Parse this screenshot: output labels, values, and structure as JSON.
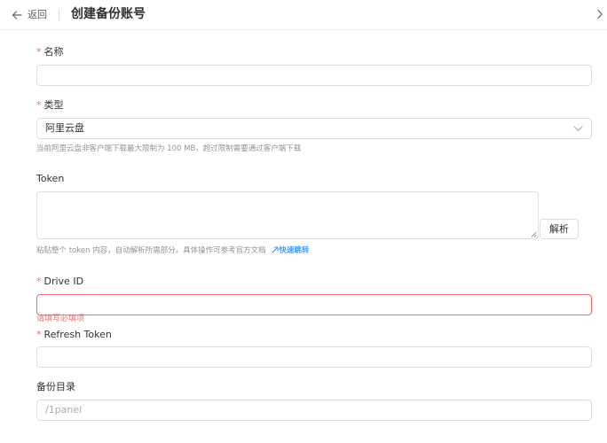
{
  "header": {
    "back_label": "返回",
    "title": "创建备份账号"
  },
  "form": {
    "required_mark": "*",
    "name": {
      "label": "名称",
      "value": ""
    },
    "type": {
      "label": "类型",
      "selected": "阿里云盘",
      "help": "当前阿里云盘非客户端下载最大限制为 100 MB，超过限制需要通过客户端下载"
    },
    "token": {
      "label": "Token",
      "value": "",
      "parse_button": "解析",
      "help": "粘贴整个 token 内容，自动解析所需部分，具体操作可参考官方文档",
      "link_label": "快速跳转"
    },
    "drive_id": {
      "label": "Drive ID",
      "value": "",
      "error": "请填写必填项"
    },
    "refresh_token": {
      "label": "Refresh Token",
      "value": ""
    },
    "backup_dir": {
      "label": "备份目录",
      "placeholder": "/1panel"
    }
  },
  "colors": {
    "required": "#f56c6c",
    "link": "#409eff",
    "error_border": "#f56c6c"
  },
  "icons": {
    "back": "arrow-left-icon",
    "close": "chevron-right-icon",
    "select": "chevron-down-icon",
    "link": "jump-icon"
  }
}
